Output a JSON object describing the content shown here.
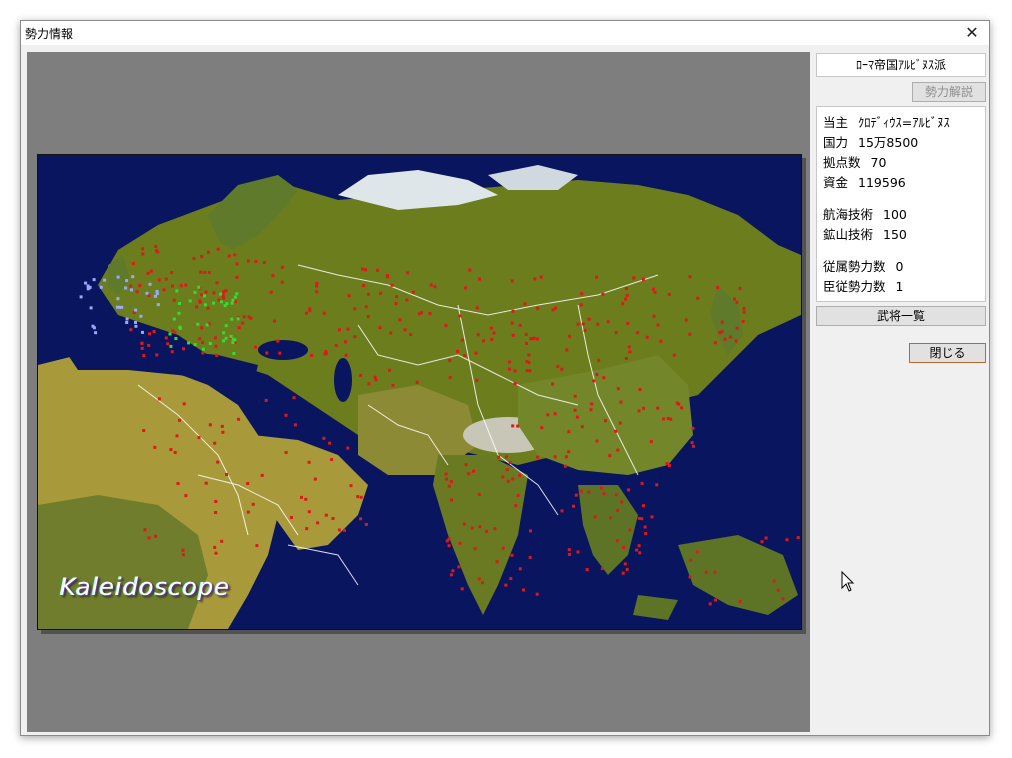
{
  "window": {
    "title": "勢力情報"
  },
  "sidebar": {
    "faction_name": "ﾛｰﾏ帝国ｱﾙﾋﾞﾇｽ派",
    "explain_button": "勢力解説",
    "info": [
      {
        "label": "当主",
        "value": "ｸﾛﾃﾞｨｳｽ=ｱﾙﾋﾞﾇｽ"
      },
      {
        "label": "国力",
        "value": "15万8500"
      },
      {
        "label": "拠点数",
        "value": "70"
      },
      {
        "label": "資金",
        "value": "119596"
      },
      {
        "label": "航海技術",
        "value": "100"
      },
      {
        "label": "鉱山技術",
        "value": "150"
      },
      {
        "label": "従属勢力数",
        "value": "0"
      },
      {
        "label": "臣従勢力数",
        "value": "1"
      }
    ],
    "officers_button": "武将一覧",
    "close_button": "閉じる"
  },
  "map": {
    "logo": "Kaleidoscope",
    "colors": {
      "sea": "#0a1560",
      "land": "#6c7d1e",
      "desert": "#a89a3a",
      "snow": "#dfe6ea",
      "border": "#ffffff",
      "city_enemy": "#e01818",
      "city_player": "#33dd33",
      "city_ally": "#9aa8ff"
    }
  },
  "icons": {
    "close": "close-icon",
    "cursor": "mouse-pointer-icon"
  }
}
